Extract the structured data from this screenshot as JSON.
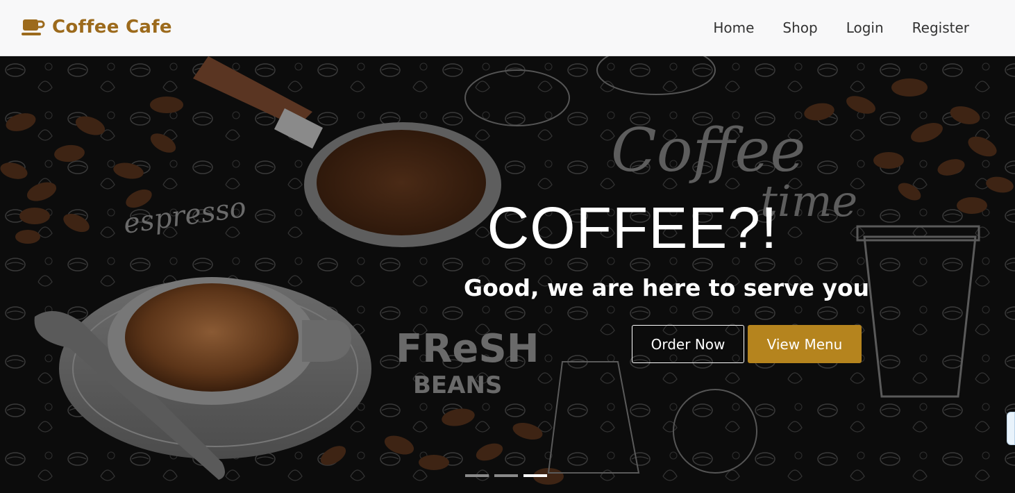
{
  "navbar": {
    "brand": "Coffee Cafe",
    "brand_icon": "coffee-cup-icon",
    "brand_color": "#9c6a1c",
    "links": [
      "Home",
      "Shop",
      "Login",
      "Register"
    ]
  },
  "hero": {
    "title": "COFFEE?!",
    "subtitle": "Good, we are here to serve you",
    "primary_button": "Order Now",
    "secondary_button": "View Menu",
    "accent_color": "#b5841e",
    "art_text": {
      "espresso": "espresso",
      "fresh": "FReSH",
      "beans": "BEANS",
      "coffee": "Coffee",
      "time": "time"
    },
    "slides": {
      "count": 3,
      "active": 3
    }
  }
}
